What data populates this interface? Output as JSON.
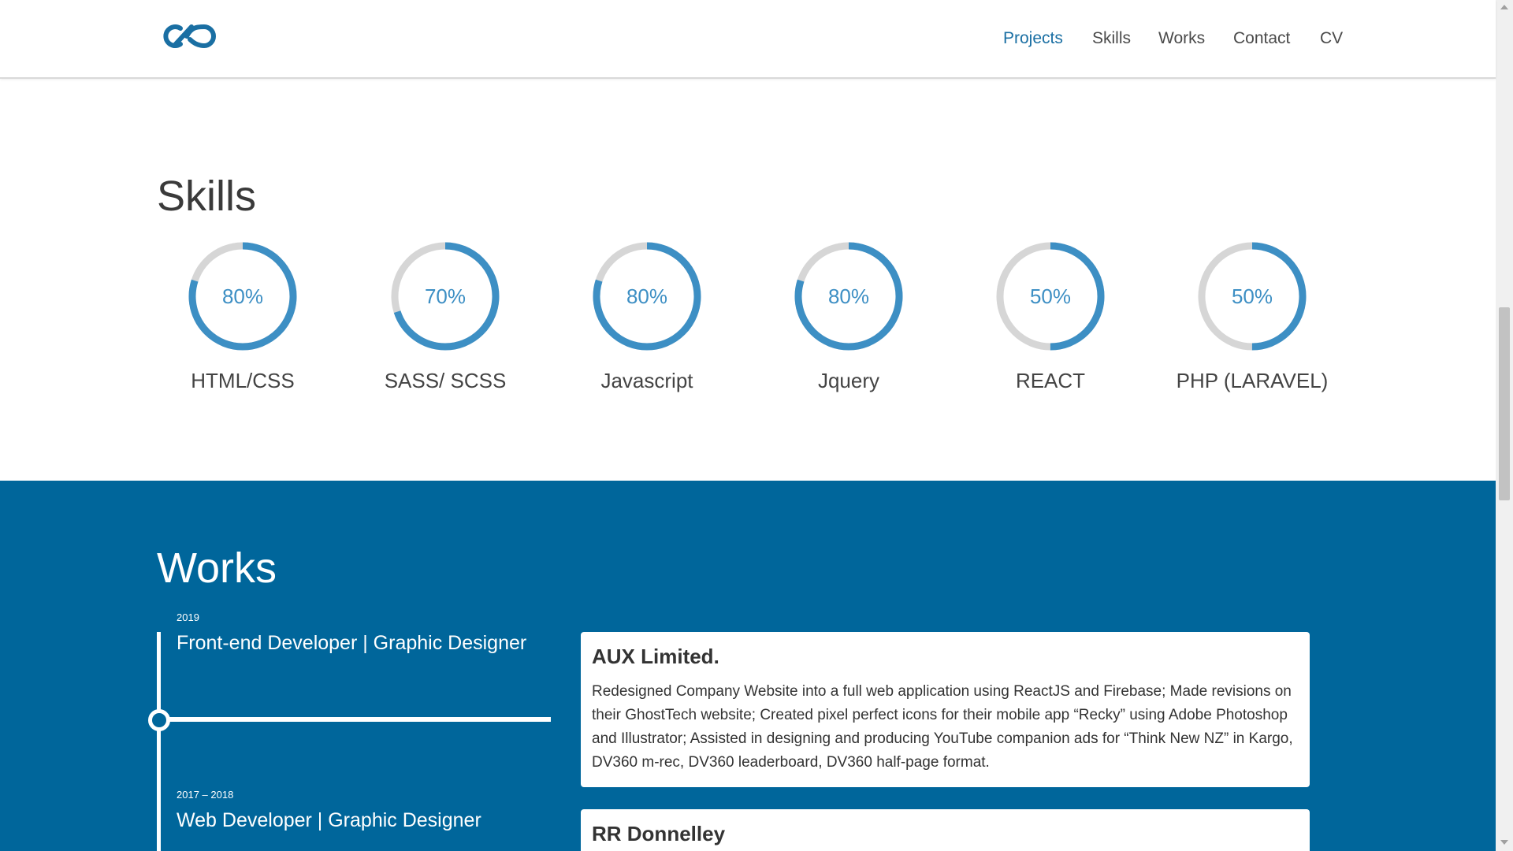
{
  "nav": {
    "items": [
      {
        "label": "Projects",
        "active": true
      },
      {
        "label": "Skills",
        "active": false
      },
      {
        "label": "Works",
        "active": false
      },
      {
        "label": "Contact",
        "active": false
      },
      {
        "label": "CV",
        "active": false
      }
    ]
  },
  "skills": {
    "title": "Skills",
    "items": [
      {
        "name": "HTML/CSS",
        "percent_label": "80%",
        "level": 0.8
      },
      {
        "name": "SASS/ SCSS",
        "percent_label": "70%",
        "level": 0.7
      },
      {
        "name": "Javascript",
        "percent_label": "80%",
        "level": 0.8
      },
      {
        "name": "Jquery",
        "percent_label": "80%",
        "level": 0.8
      },
      {
        "name": "REACT",
        "percent_label": "50%",
        "level": 0.5
      },
      {
        "name": "PHP (LARAVEL)",
        "percent_label": "50%",
        "level": 0.5
      }
    ]
  },
  "works": {
    "title": "Works",
    "entries": [
      {
        "year": "2019",
        "role": "Front-end Developer | Graphic Designer",
        "company": "AUX Limited.",
        "description": "Redesigned Company Website into a full web application using ReactJS and Firebase; Made revisions on their GhostTech website; Created pixel perfect icons for their mobile app “Recky” using Adobe Photoshop and Illustrator; Assisted in designing and producing YouTube companion ads for “Think New NZ” in Kargo, DV360 m-rec, DV360 leaderboard, DV360 half-page format."
      },
      {
        "year": "2017 – 2018",
        "role": "Web Developer | Graphic Designer",
        "company": "RR Donnelley",
        "description": ""
      }
    ]
  },
  "colors": {
    "accent": "#1a6fa3",
    "ring": "#3d8fc4",
    "ring_track": "#d6d6d6",
    "works_bg": "#00669b"
  }
}
